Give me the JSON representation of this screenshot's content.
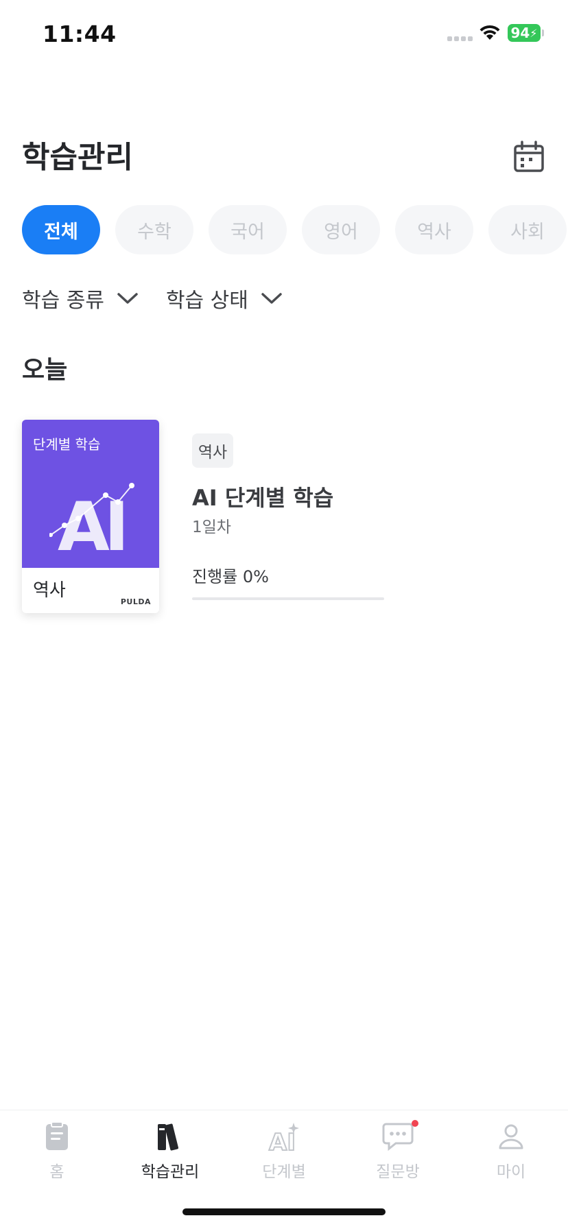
{
  "status_bar": {
    "time": "11:44",
    "battery": "94"
  },
  "header": {
    "title": "학습관리"
  },
  "chips": [
    {
      "label": "전체",
      "active": true
    },
    {
      "label": "수학",
      "active": false
    },
    {
      "label": "국어",
      "active": false
    },
    {
      "label": "영어",
      "active": false
    },
    {
      "label": "역사",
      "active": false
    },
    {
      "label": "사회",
      "active": false
    }
  ],
  "filters": [
    {
      "label": "학습 종류"
    },
    {
      "label": "학습 상태"
    }
  ],
  "section": {
    "title": "오늘"
  },
  "study_item": {
    "thumbnail_label": "단계별 학습",
    "thumbnail_subject": "역사",
    "thumbnail_brand": "PULDA",
    "tag": "역사",
    "title": "AI 단계별 학습",
    "day": "1일차",
    "progress_text": "진행률 0%",
    "progress_fraction": 0
  },
  "bottom_nav": [
    {
      "label": "홈",
      "icon": "home-icon",
      "active": false
    },
    {
      "label": "학습관리",
      "icon": "books-icon",
      "active": true
    },
    {
      "label": "단계별",
      "icon": "ai-step-icon",
      "active": false
    },
    {
      "label": "질문방",
      "icon": "chat-icon",
      "active": false,
      "badge": true
    },
    {
      "label": "마이",
      "icon": "profile-icon",
      "active": false
    }
  ],
  "colors": {
    "accent": "#1a7ef5",
    "thumbnail": "#6e52e3",
    "battery": "#34c759",
    "badge": "#f04452"
  }
}
